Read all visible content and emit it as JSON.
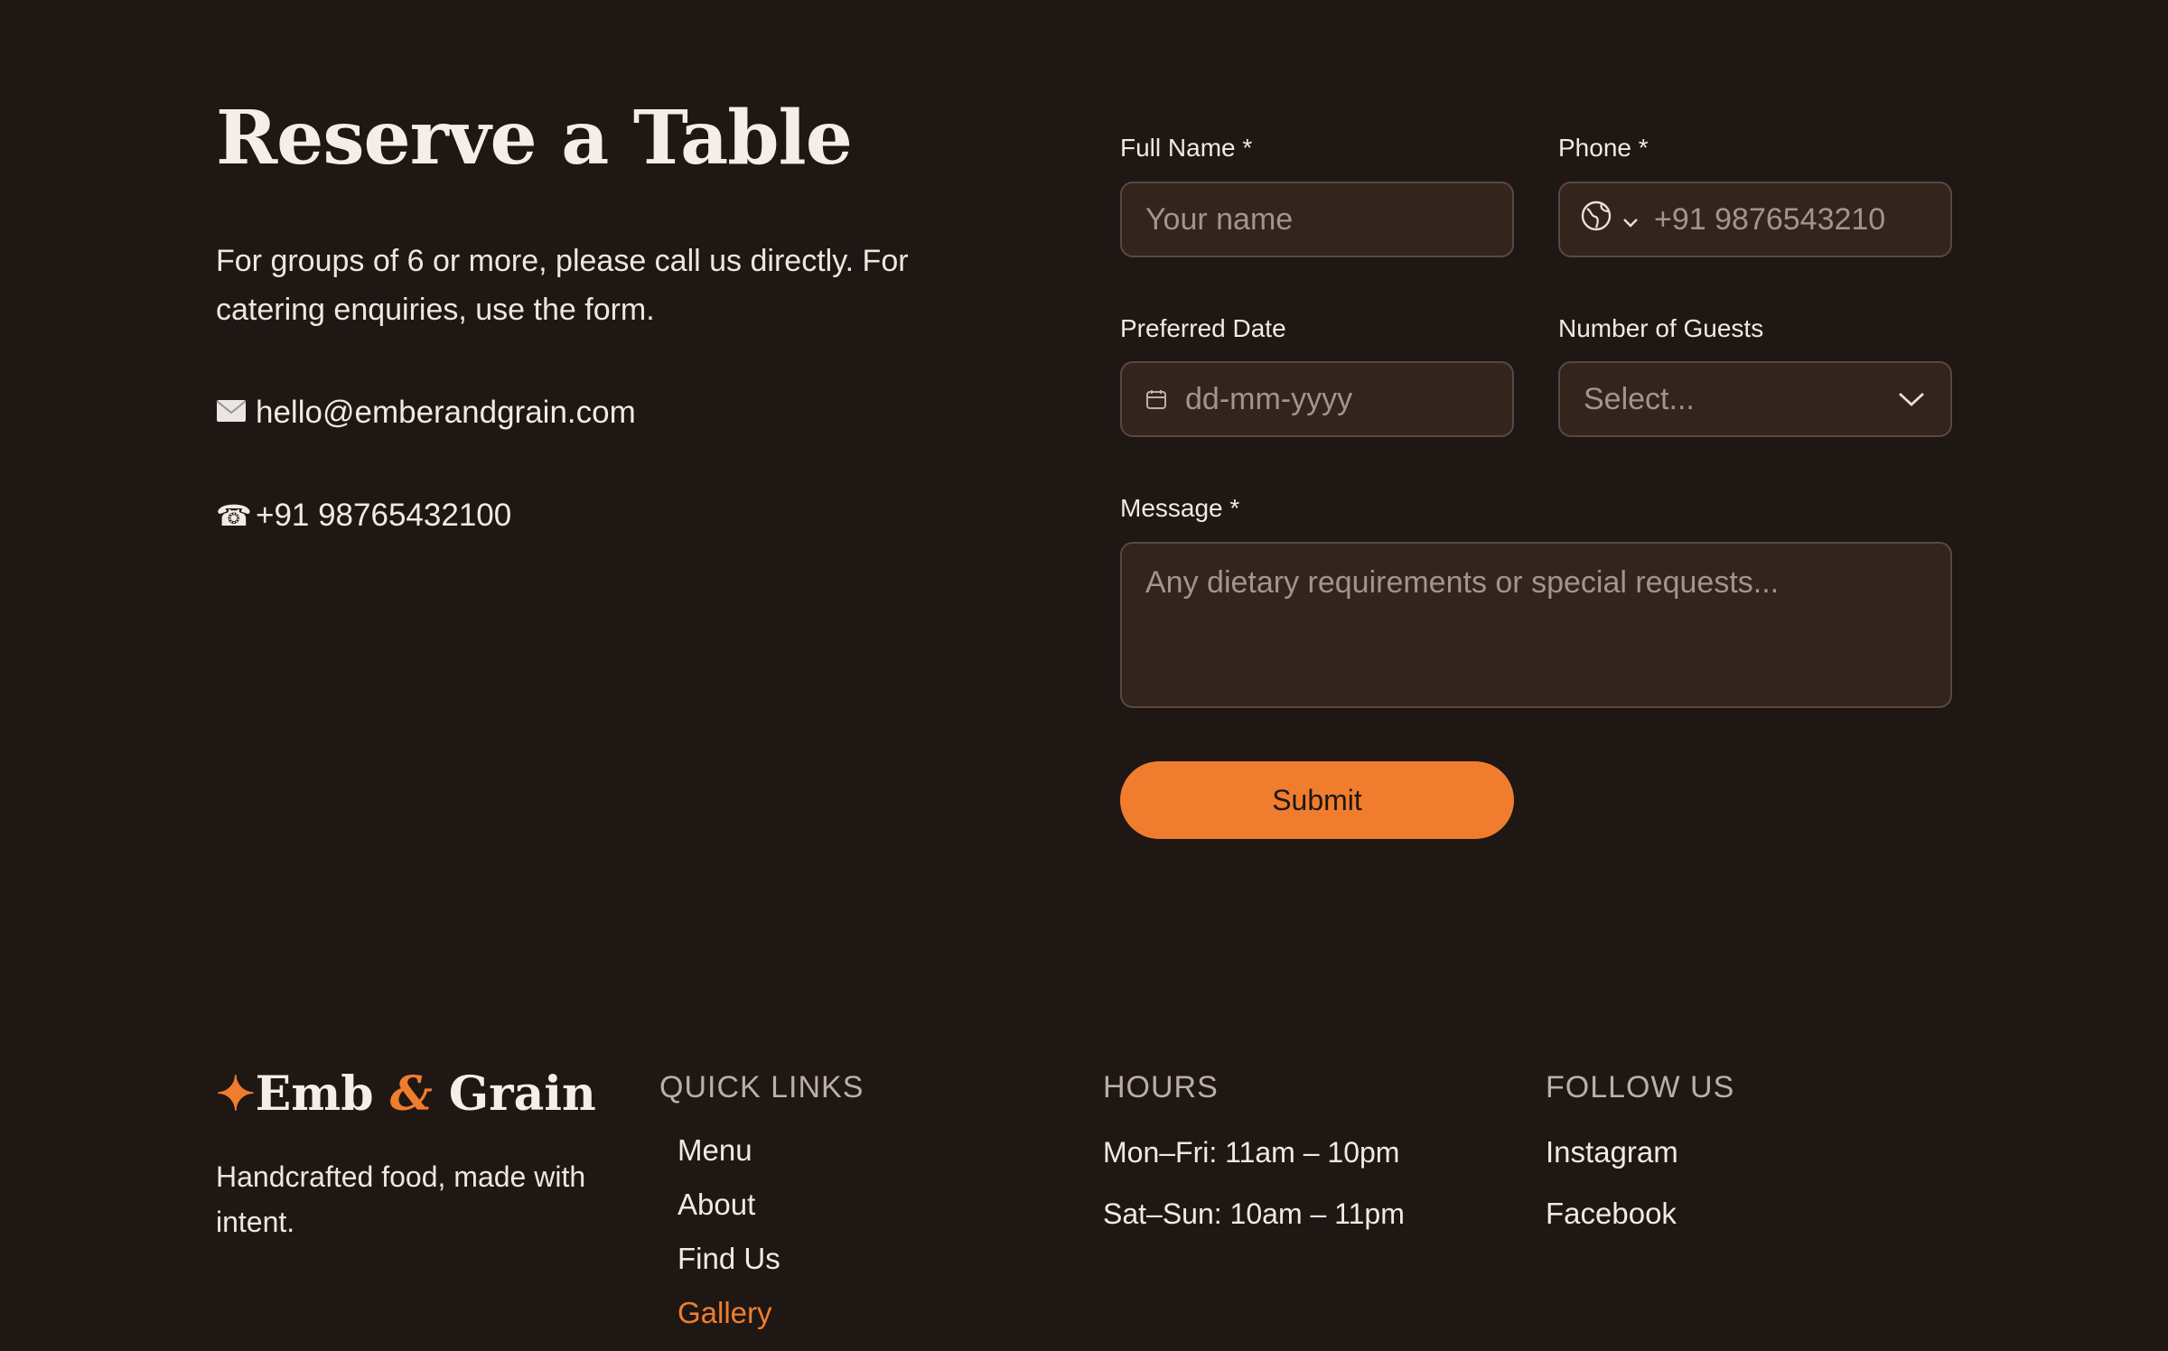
{
  "reserve": {
    "title": "Reserve a Table",
    "intro": "For groups of 6 or more, please call us directly. For catering enquiries, use the form.",
    "email": "hello@emberandgrain.com",
    "phone": "+91 98765432100",
    "email_icon": "envelope-icon",
    "phone_icon": "telephone-icon"
  },
  "form": {
    "full_name": {
      "label": "Full Name  *",
      "placeholder": "Your name",
      "value": ""
    },
    "phone": {
      "label": "Phone *",
      "placeholder": "+91 9876543210",
      "value": ""
    },
    "date": {
      "label": "Preferred Date",
      "placeholder": "dd-mm-yyyy",
      "value": ""
    },
    "guests": {
      "label": "Number of Guests",
      "selected": "Select..."
    },
    "message": {
      "label": "Message *",
      "placeholder": "Any dietary requirements or special requests...",
      "value": ""
    },
    "submit_label": "Submit"
  },
  "footer": {
    "logo": {
      "star": "✦",
      "part1": "Emb ",
      "amp": "&",
      "part2": " Grain"
    },
    "tagline": "Handcrafted food, made with intent.",
    "quick_links": {
      "heading": "QUICK LINKS",
      "items": [
        "Menu",
        "About",
        "Find Us",
        "Gallery"
      ],
      "active": "Gallery"
    },
    "hours": {
      "heading": "HOURS",
      "lines": [
        "Mon–Fri: 11am – 10pm",
        "Sat–Sun: 10am – 11pm"
      ]
    },
    "follow": {
      "heading": "FOLLOW US",
      "items": [
        "Instagram",
        "Facebook"
      ]
    }
  },
  "colors": {
    "background": "#1e1714",
    "accent": "#f07d2e",
    "field_bg": "#33241e",
    "field_border": "#5a4840"
  }
}
